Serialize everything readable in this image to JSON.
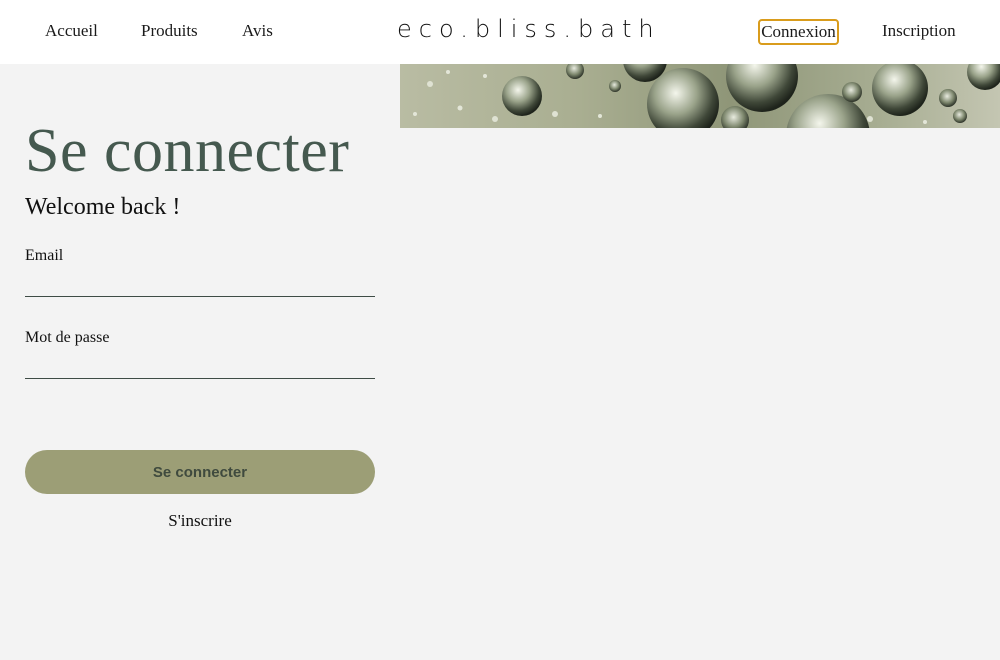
{
  "header": {
    "nav": {
      "home": "Accueil",
      "products": "Produits",
      "reviews": "Avis"
    },
    "logo": "eco.bliss.bath",
    "login": "Connexion",
    "signup": "Inscription"
  },
  "main": {
    "title": "Se connecter",
    "subtitle": "Welcome back !",
    "form": {
      "email_label": "Email",
      "email_value": "",
      "password_label": "Mot de passe",
      "password_value": "",
      "submit_label": "Se connecter",
      "signup_link": "S'inscrire"
    }
  },
  "colors": {
    "title": "#45594f",
    "button": "#9c9e76",
    "button_text": "#3f4a3e",
    "focus_outline": "#d99c1c",
    "background": "#f3f3f3"
  }
}
